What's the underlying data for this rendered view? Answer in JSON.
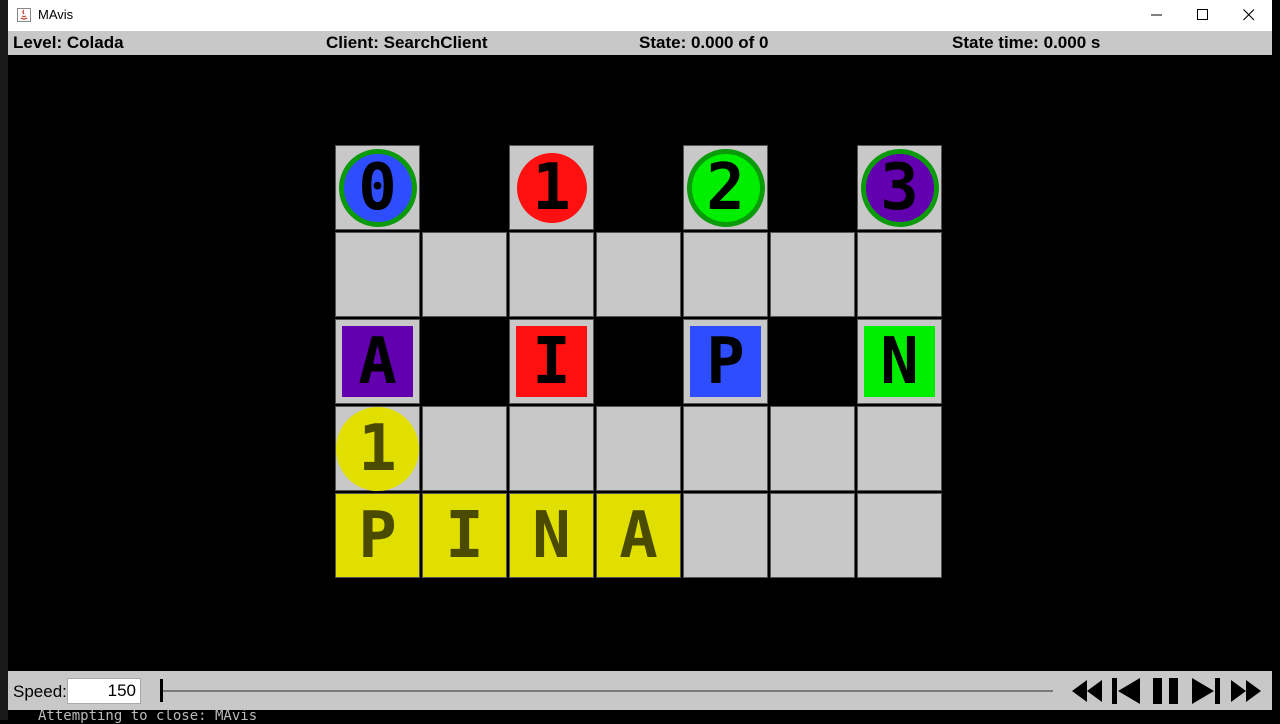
{
  "window": {
    "title": "MAvis"
  },
  "info": {
    "level": "Level: Colada",
    "client": "Client: SearchClient",
    "state": "State: 0.000 of 0",
    "state_time": "State time: 0.000 s"
  },
  "agents": [
    {
      "label": "0",
      "fill": "#2e4dff",
      "glyph": "#000000",
      "goal_ring": true
    },
    {
      "label": "1",
      "fill": "#ff1010",
      "glyph": "#000000",
      "goal_ring": false
    },
    {
      "label": "2",
      "fill": "#00ee00",
      "glyph": "#000000",
      "goal_ring": true
    },
    {
      "label": "3",
      "fill": "#6200b0",
      "glyph": "#000000",
      "goal_ring": true
    }
  ],
  "boxes": [
    {
      "label": "A",
      "color": "#6200b0"
    },
    {
      "label": "I",
      "color": "#ff1010"
    },
    {
      "label": "P",
      "color": "#2e4dff"
    },
    {
      "label": "N",
      "color": "#00ee00"
    }
  ],
  "agent_goal": {
    "label": "1",
    "color": "#e0df00"
  },
  "goal_word": [
    "P",
    "I",
    "N",
    "A"
  ],
  "colors": {
    "goal": "#e0df00",
    "goal_text": "#4a4a00",
    "floor": "#c8c8c8",
    "wall": "#000000",
    "goal_ring": "#0a9a0a"
  },
  "controls": {
    "speed_label": "Speed:",
    "speed_value": "150",
    "icons": [
      "skip-to-start-icon",
      "step-back-icon",
      "pause-icon",
      "step-forward-icon",
      "skip-to-end-icon"
    ]
  },
  "console": {
    "text": "Attempting to close: MAvis"
  }
}
